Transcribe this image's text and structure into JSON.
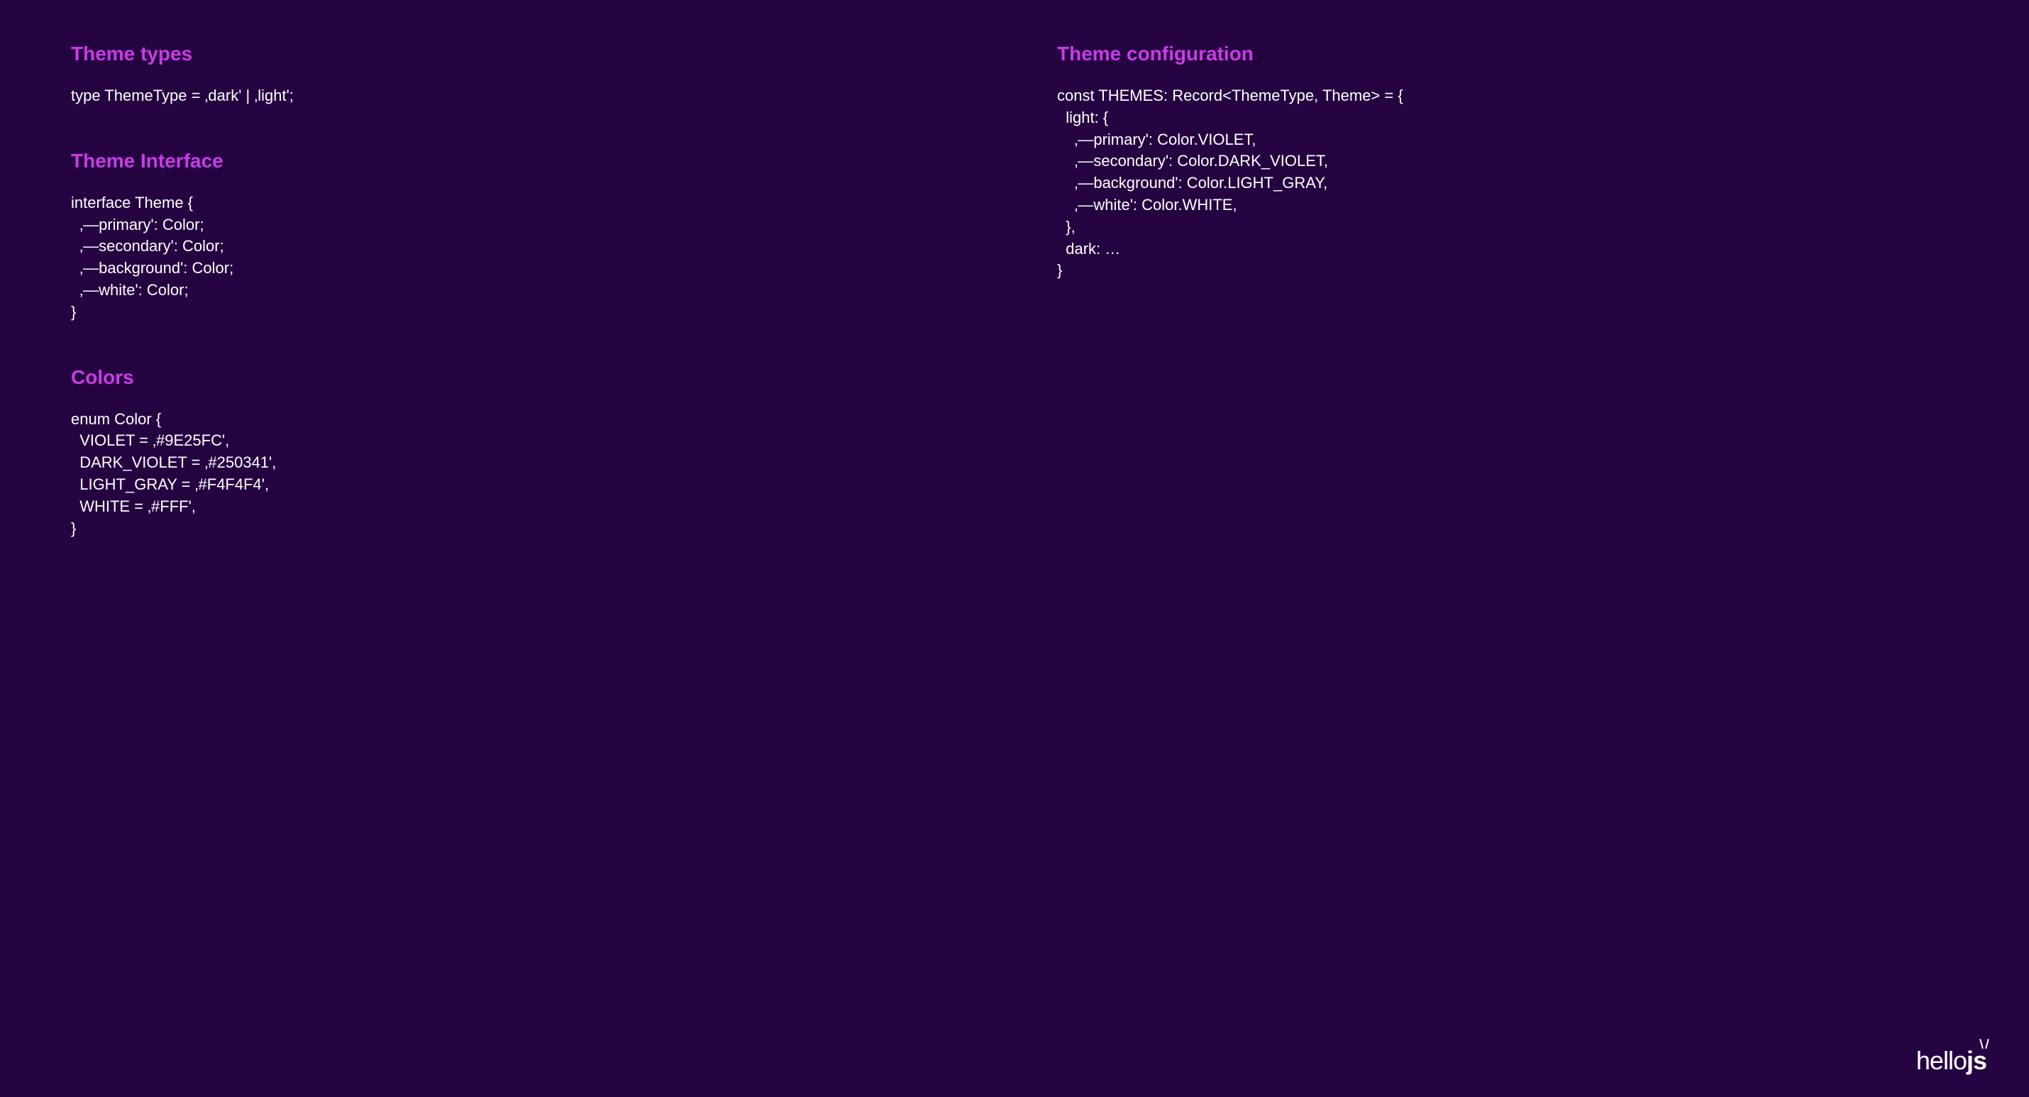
{
  "leftColumn": {
    "section1": {
      "heading": "Theme types",
      "code": "type ThemeType = ‚dark' | ‚light';"
    },
    "section2": {
      "heading": "Theme Interface",
      "code": "interface Theme {\n  ‚—primary': Color;\n  ‚—secondary': Color;\n  ‚—background': Color;\n  ‚—white': Color;\n}"
    },
    "section3": {
      "heading": "Colors",
      "code": "enum Color {\n  VIOLET = ‚#9E25FC',\n  DARK_VIOLET = ‚#250341',\n  LIGHT_GRAY = ‚#F4F4F4',\n  WHITE = ‚#FFF',\n}"
    }
  },
  "rightColumn": {
    "section1": {
      "heading": "Theme configuration",
      "code": "const THEMES: Record<ThemeType, Theme> = {\n  light: {\n    ‚—primary': Color.VIOLET,\n    ‚—secondary': Color.DARK_VIOLET,\n    ‚—background': Color.LIGHT_GRAY,\n    ‚—white': Color.WHITE,\n  },\n  dark: …\n}"
    }
  },
  "logo": {
    "text1": "hello",
    "text2": "js"
  }
}
